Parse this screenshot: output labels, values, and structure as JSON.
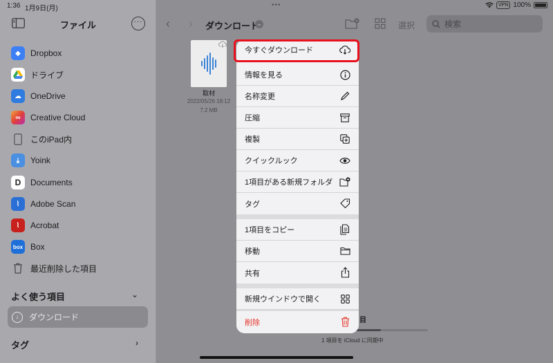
{
  "status_bar": {
    "time": "1:36",
    "date": "1月9日(月)",
    "dots": "•••",
    "vpn": "VPN",
    "battery": "100%"
  },
  "sidebar": {
    "title": "ファイル",
    "locations": [
      {
        "label": "Dropbox",
        "icon": "dropbox-icon",
        "color": "#3d80f5"
      },
      {
        "label": "ドライブ",
        "icon": "google-drive-icon",
        "color": "#ffffff"
      },
      {
        "label": "OneDrive",
        "icon": "onedrive-icon",
        "color": "#2f7be0"
      },
      {
        "label": "Creative Cloud",
        "icon": "creative-cloud-icon",
        "color": "#e0403a"
      },
      {
        "label": "このiPad内",
        "icon": "ipad-icon",
        "color": "#8e8e93"
      },
      {
        "label": "Yoink",
        "icon": "yoink-icon",
        "color": "#4a8fe0"
      },
      {
        "label": "Documents",
        "icon": "documents-icon",
        "color": "#ffffff"
      },
      {
        "label": "Adobe Scan",
        "icon": "adobe-scan-icon",
        "color": "#2a6fd6"
      },
      {
        "label": "Acrobat",
        "icon": "acrobat-icon",
        "color": "#c8201c"
      },
      {
        "label": "Box",
        "icon": "box-icon",
        "color": "#1f6fd9"
      },
      {
        "label": "最近削除した項目",
        "icon": "trash-icon",
        "color": "#8e8e93"
      }
    ],
    "favorites_title": "よく使う項目",
    "favorites": [
      {
        "label": "ダウンロード"
      }
    ],
    "tags_title": "タグ"
  },
  "main": {
    "folder_title": "ダウンロード",
    "select_label": "選択",
    "search_placeholder": "検索",
    "file": {
      "name": "取材",
      "date": "2022/05/26 18:12",
      "size": "7.2 MB"
    },
    "partial_label": "目",
    "sync_text": "1 項目を iCloud に同期中",
    "sync_progress": 0.45
  },
  "menu": {
    "items": [
      {
        "label": "今すぐダウンロード",
        "icon": "cloud-download-icon"
      },
      {
        "label": "情報を見る",
        "icon": "info-icon"
      },
      {
        "label": "名称変更",
        "icon": "pencil-icon"
      },
      {
        "label": "圧縮",
        "icon": "archive-box-icon"
      },
      {
        "label": "複製",
        "icon": "duplicate-icon"
      },
      {
        "label": "クイックルック",
        "icon": "eye-icon"
      },
      {
        "label": "1項目がある新規フォルダ",
        "icon": "folder-plus-icon"
      },
      {
        "label": "タグ",
        "icon": "tag-icon"
      },
      {
        "label": "1項目をコピー",
        "icon": "copy-doc-icon"
      },
      {
        "label": "移動",
        "icon": "folder-icon"
      },
      {
        "label": "共有",
        "icon": "share-icon"
      },
      {
        "label": "新規ウインドウで開く",
        "icon": "grid-icon"
      },
      {
        "label": "削除",
        "icon": "trash-icon"
      }
    ]
  },
  "colors": {
    "accent_red": "#e8101c",
    "delete_red": "#e5342a"
  }
}
